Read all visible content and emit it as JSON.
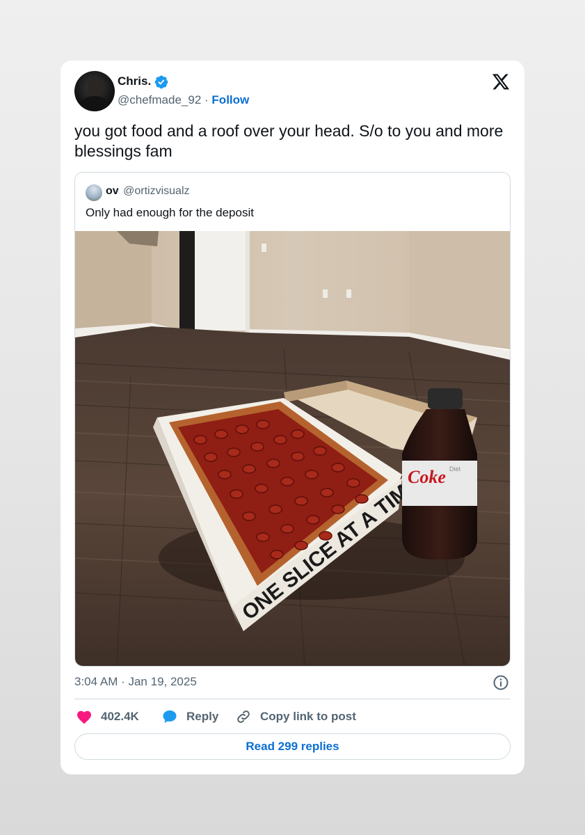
{
  "tweet": {
    "author_name": "Chris.",
    "handle": "@chefmade_92",
    "separator": "·",
    "follow_label": "Follow",
    "text": "you got food and a roof over your head. S/o to you and more blessings fam",
    "verified": true,
    "brand_color": "#0b6fd3",
    "like_color": "#f91880"
  },
  "quoted": {
    "author_name": "ov",
    "handle": "@ortizvisualz",
    "text": "Only had enough for the deposit",
    "box_text": "ONE SLICE AT A TIME",
    "bottle_text": "Coke",
    "bottle_sub": "Diet"
  },
  "footer": {
    "timestamp": "3:04 AM · Jan 19, 2025",
    "likes": "402.4K",
    "reply_label": "Reply",
    "copy_label": "Copy link to post",
    "read_replies_label": "Read 299 replies"
  },
  "icons": {
    "logo": "x-logo-icon",
    "verified": "verified-badge-icon",
    "info": "info-icon",
    "like": "heart-icon",
    "reply": "speech-bubble-icon",
    "copy": "link-icon"
  }
}
